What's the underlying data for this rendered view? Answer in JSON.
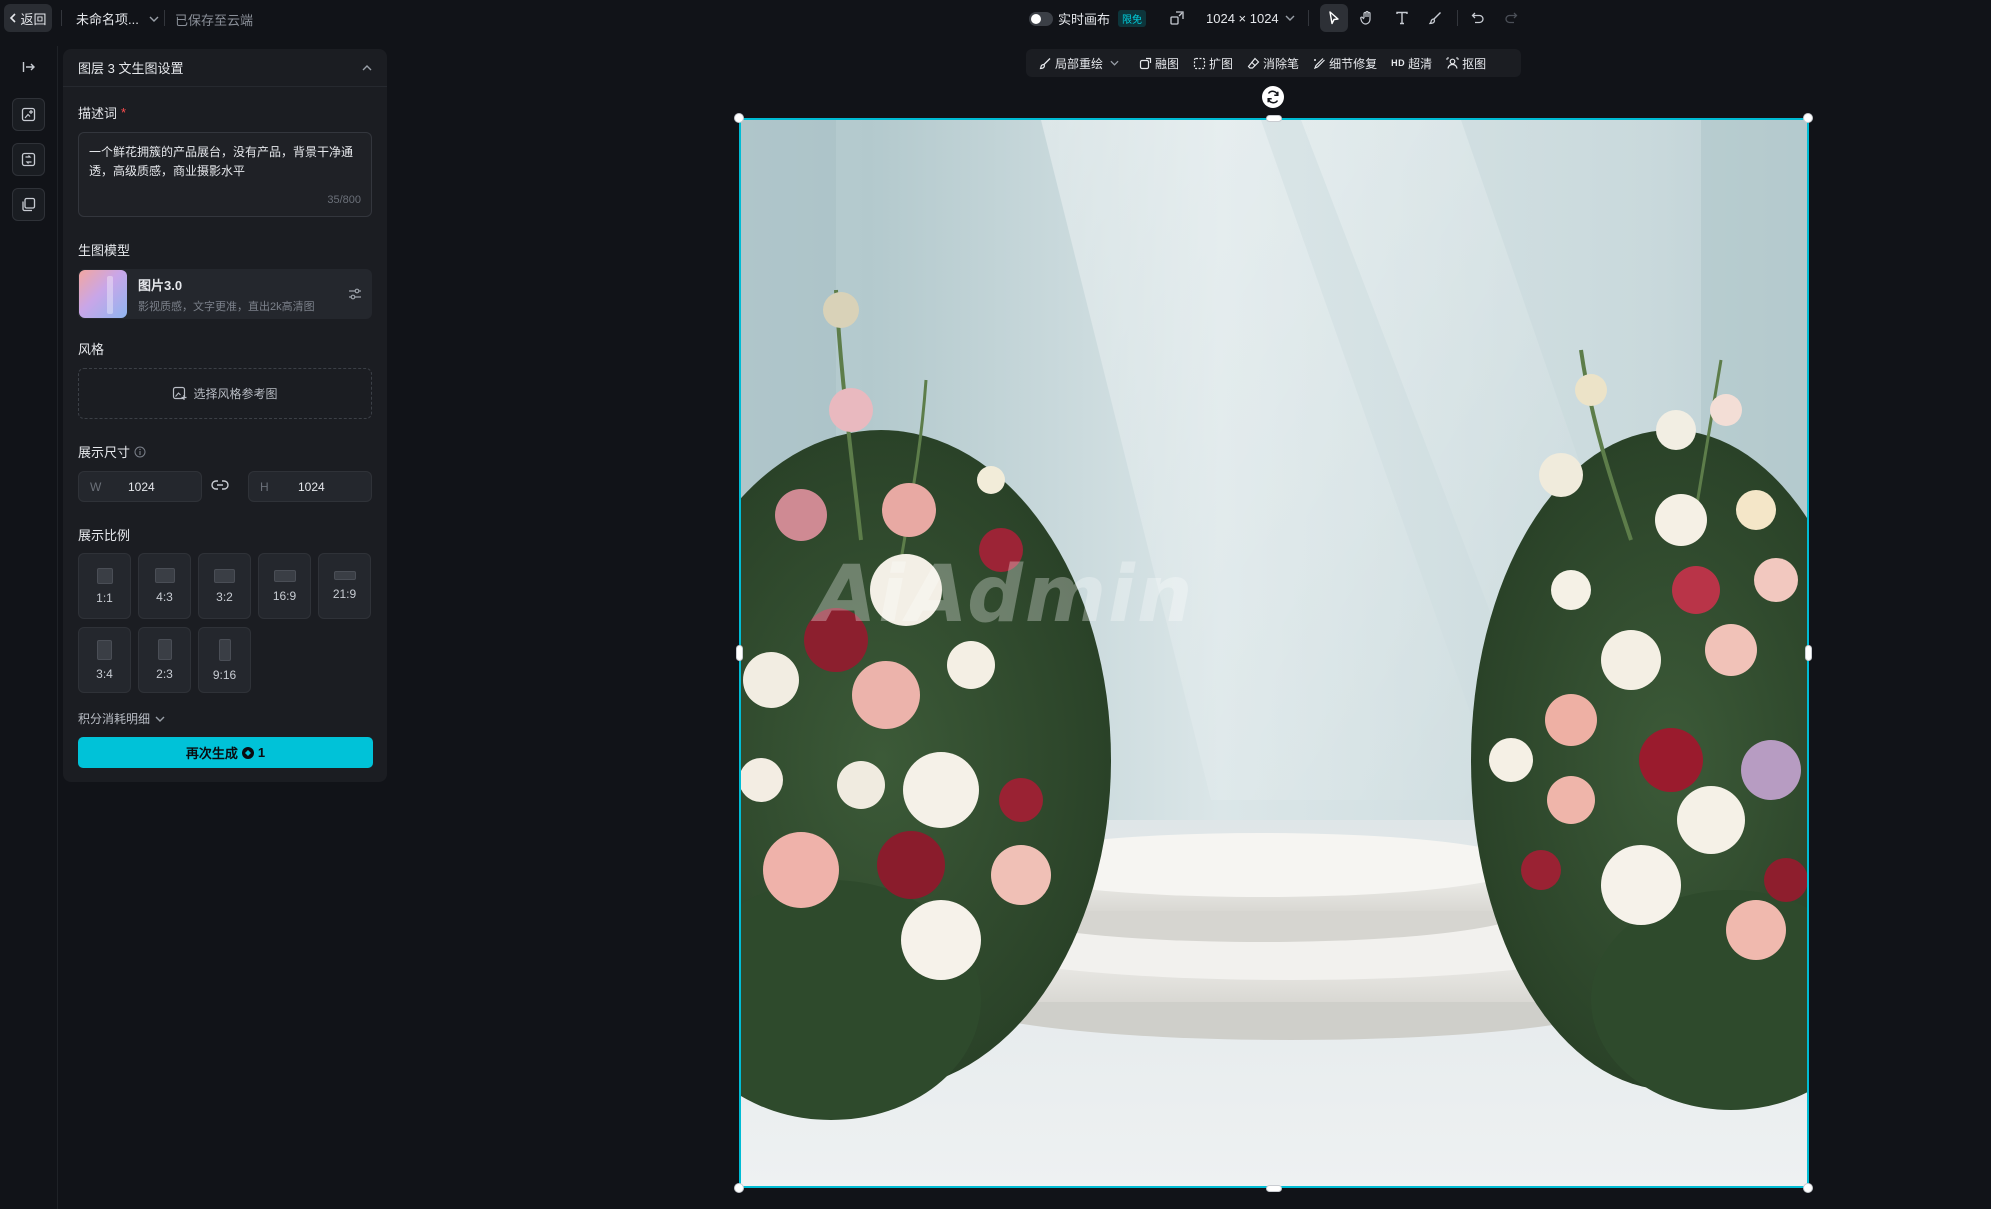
{
  "header": {
    "back_label": "返回",
    "project_name": "未命名项...",
    "save_status": "已保存至云端",
    "realtime_label": "实时画布",
    "realtime_badge": "限免",
    "canvas_size": "1024 × 1024"
  },
  "toolbar_icons": [
    "select-arrow-icon",
    "hand-pan-icon",
    "text-tool-icon",
    "brush-icon",
    "undo-icon",
    "redo-icon"
  ],
  "edit_toolbar": {
    "items": [
      {
        "label": "局部重绘",
        "icon": "local-redraw-icon"
      },
      {
        "label": "融图",
        "icon": "blend-icon"
      },
      {
        "label": "扩图",
        "icon": "expand-icon"
      },
      {
        "label": "消除笔",
        "icon": "eraser-icon"
      },
      {
        "label": "细节修复",
        "icon": "detail-fix-icon"
      },
      {
        "label": "超清",
        "icon": "hd-icon",
        "prefix": "HD"
      },
      {
        "label": "抠图",
        "icon": "cutout-icon"
      }
    ]
  },
  "panel": {
    "title": "图层 3 文生图设置",
    "prompt": {
      "label": "描述词",
      "required_mark": "*",
      "value": "一个鲜花拥簇的产品展台，没有产品，背景干净通透，高级质感，商业摄影水平",
      "count": "35/800"
    },
    "model": {
      "label": "生图模型",
      "name": "图片3.0",
      "desc": "影视质感，文字更准，直出2k高清图"
    },
    "style": {
      "label": "风格",
      "button": "选择风格参考图"
    },
    "size": {
      "label": "展示尺寸",
      "w_prefix": "W",
      "w_value": "1024",
      "h_prefix": "H",
      "h_value": "1024"
    },
    "ratio": {
      "label": "展示比例",
      "options": [
        "1:1",
        "4:3",
        "3:2",
        "16:9",
        "21:9",
        "3:4",
        "2:3",
        "9:16"
      ]
    },
    "credits_label": "积分消耗明细",
    "regen": {
      "label": "再次生成",
      "cost": "1"
    }
  },
  "canvas": {
    "watermark": "AiAdmin"
  },
  "colors": {
    "accent": "#00c2d8",
    "selection": "#00bcd4",
    "background": "#111318",
    "panel": "#1b1d22"
  }
}
